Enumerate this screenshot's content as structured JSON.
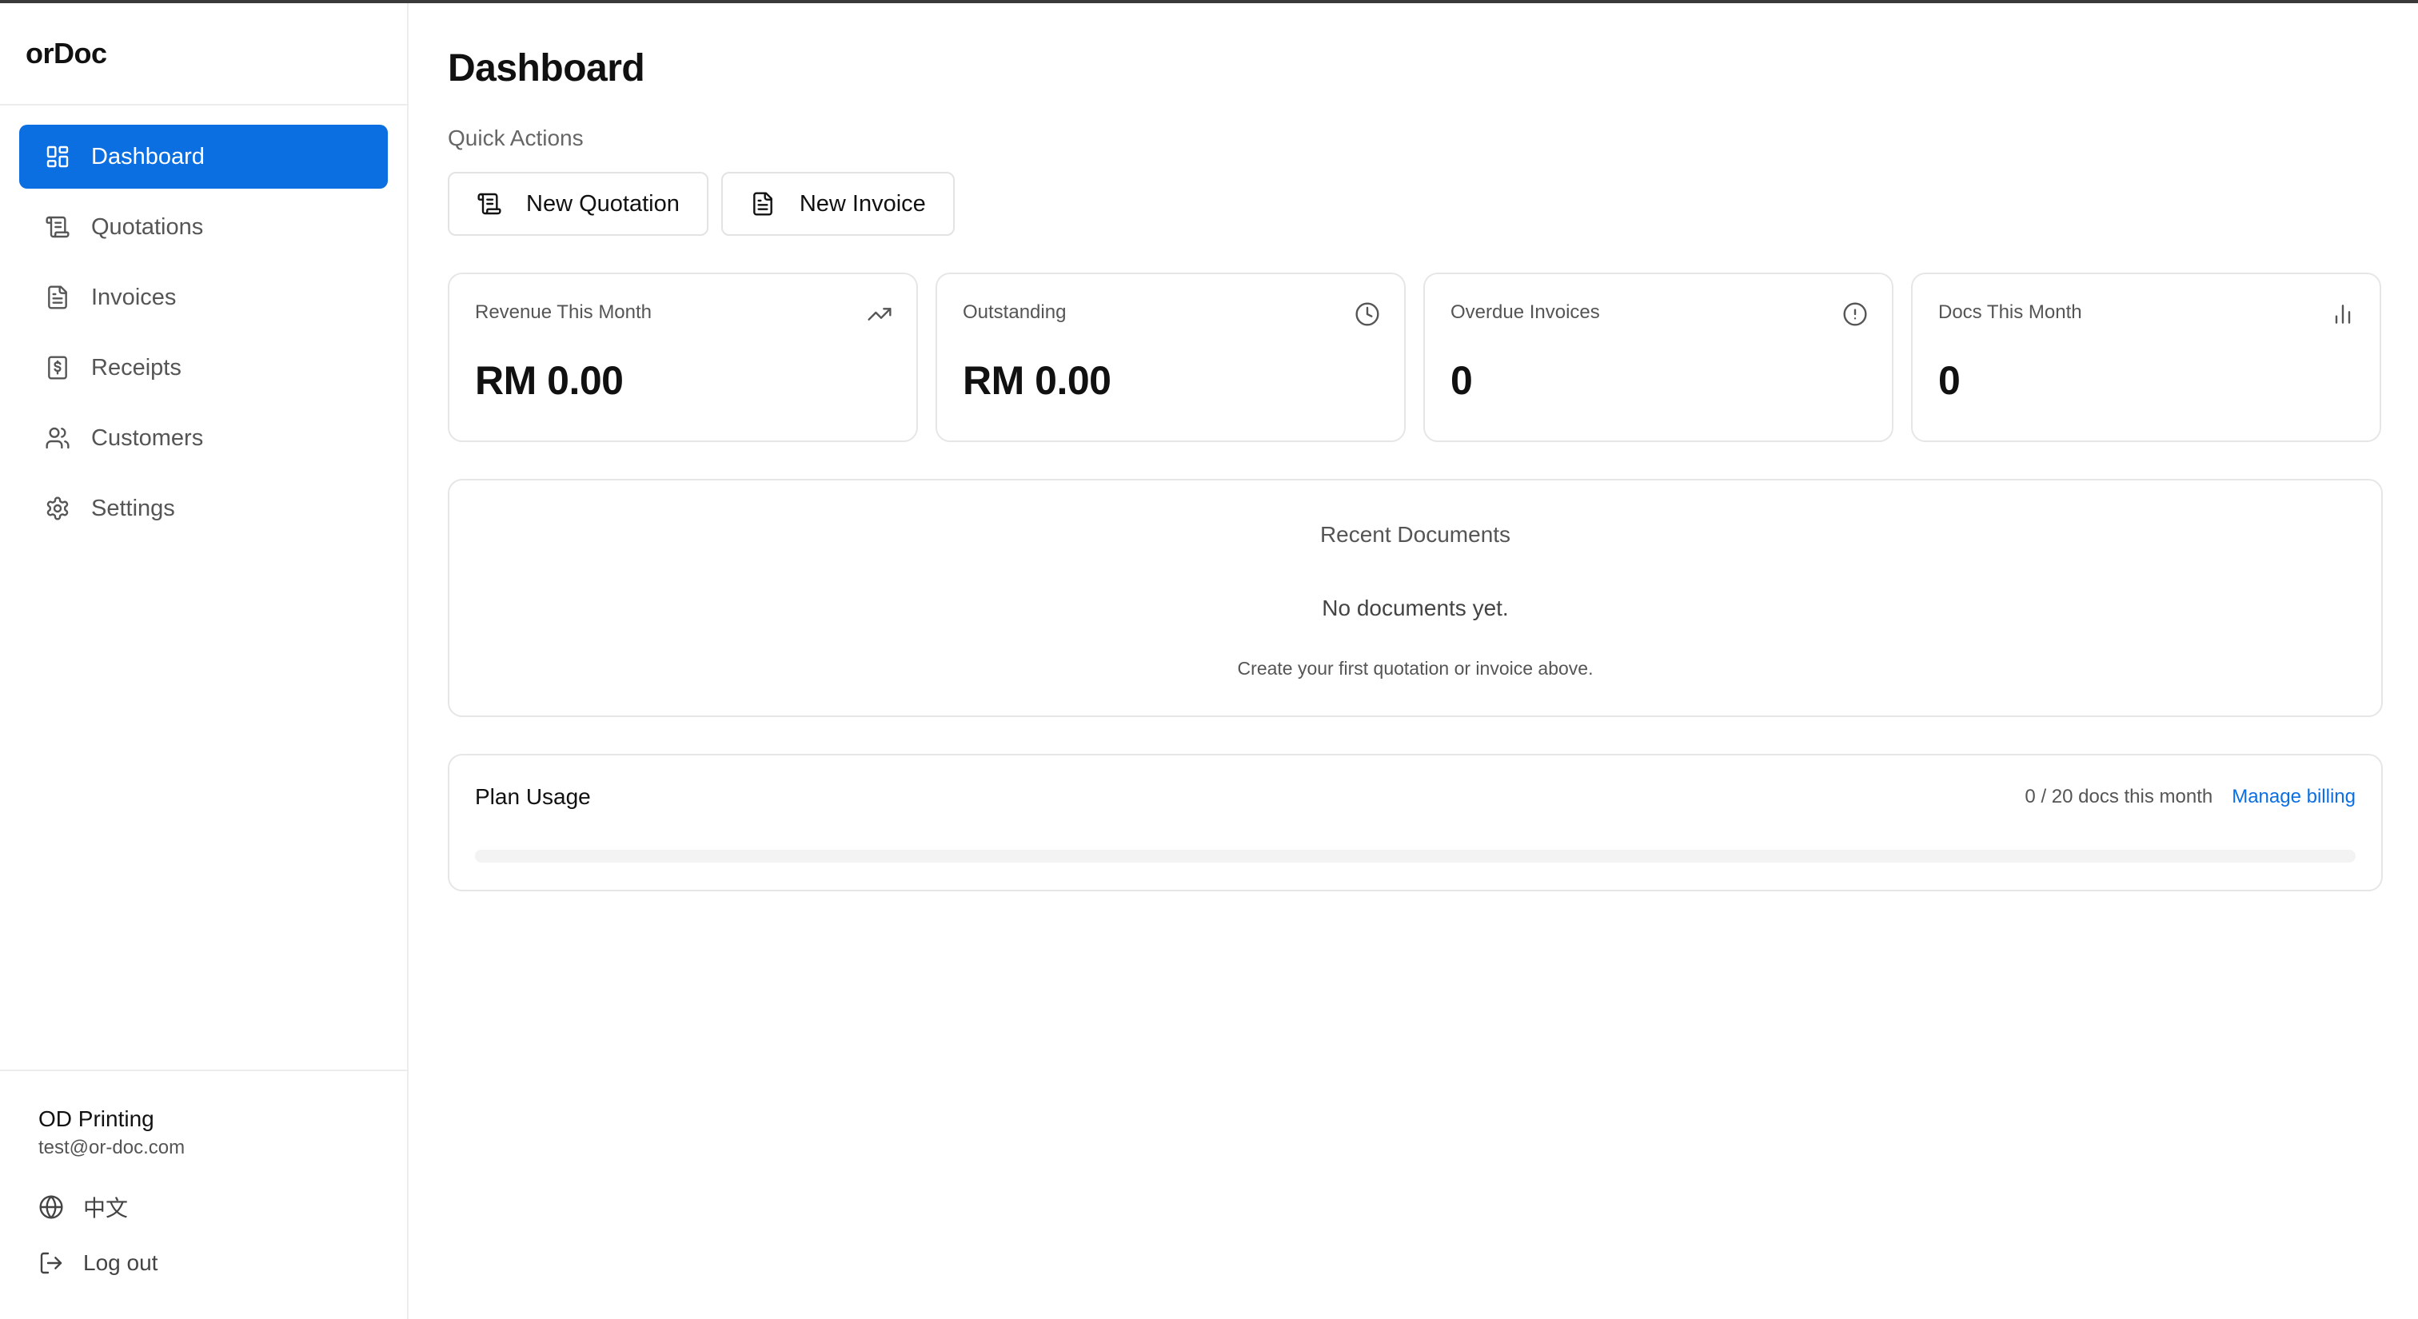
{
  "app": {
    "brand": "orDoc"
  },
  "sidebar": {
    "items": [
      {
        "label": "Dashboard",
        "icon": "dashboard-icon",
        "active": true
      },
      {
        "label": "Quotations",
        "icon": "quotation-icon",
        "active": false
      },
      {
        "label": "Invoices",
        "icon": "invoice-icon",
        "active": false
      },
      {
        "label": "Receipts",
        "icon": "receipt-icon",
        "active": false
      },
      {
        "label": "Customers",
        "icon": "users-icon",
        "active": false
      },
      {
        "label": "Settings",
        "icon": "gear-icon",
        "active": false
      }
    ],
    "footer": {
      "org_name": "OD Printing",
      "email": "test@or-doc.com",
      "language": "中文",
      "logout": "Log out"
    }
  },
  "main": {
    "title": "Dashboard",
    "quick_actions": {
      "label": "Quick Actions",
      "new_quotation": "New Quotation",
      "new_invoice": "New Invoice"
    },
    "stats": [
      {
        "label": "Revenue This Month",
        "value": "RM 0.00",
        "icon": "trending-up-icon"
      },
      {
        "label": "Outstanding",
        "value": "RM 0.00",
        "icon": "clock-icon"
      },
      {
        "label": "Overdue Invoices",
        "value": "0",
        "icon": "alert-circle-icon"
      },
      {
        "label": "Docs This Month",
        "value": "0",
        "icon": "bar-chart-icon"
      }
    ],
    "recent": {
      "title": "Recent Documents",
      "empty": "No documents yet.",
      "hint": "Create your first quotation or invoice above."
    },
    "plan": {
      "title": "Plan Usage",
      "count": "0 / 20 docs this month",
      "link": "Manage billing",
      "used_fraction": 0
    }
  },
  "colors": {
    "accent": "#0b6fe2",
    "border": "#e6e6e6",
    "muted": "#555555"
  }
}
